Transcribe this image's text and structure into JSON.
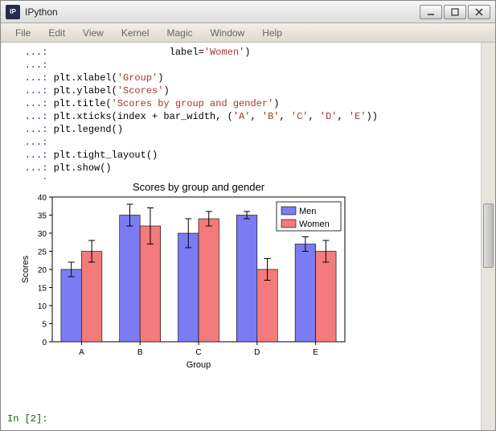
{
  "window": {
    "title": "IPython"
  },
  "menu": {
    "items": [
      "File",
      "Edit",
      "View",
      "Kernel",
      "Magic",
      "Window",
      "Help"
    ]
  },
  "code": {
    "prompt": "   ...: ",
    "lines": [
      "                    label='Women')",
      "",
      "plt.xlabel('Group')",
      "plt.ylabel('Scores')",
      "plt.title('Scores by group and gender')",
      "plt.xticks(index + bar_width, ('A', 'B', 'C', 'D', 'E'))",
      "plt.legend()",
      "",
      "plt.tight_layout()",
      "plt.show()",
      ""
    ]
  },
  "bottom_prompt": "In [2]:",
  "chart_data": {
    "type": "bar",
    "title": "Scores by group and gender",
    "xlabel": "Group",
    "ylabel": "Scores",
    "categories": [
      "A",
      "B",
      "C",
      "D",
      "E"
    ],
    "ylim": [
      0,
      40
    ],
    "yticks": [
      0,
      5,
      10,
      15,
      20,
      25,
      30,
      35,
      40
    ],
    "series": [
      {
        "name": "Men",
        "color": "#7b7bf3",
        "values": [
          20,
          35,
          30,
          35,
          27
        ],
        "errors": [
          2,
          3,
          4,
          1,
          2
        ]
      },
      {
        "name": "Women",
        "color": "#f37b7b",
        "values": [
          25,
          32,
          34,
          20,
          25
        ],
        "errors": [
          3,
          5,
          2,
          3,
          3
        ]
      }
    ],
    "legend_position": "upper right"
  }
}
